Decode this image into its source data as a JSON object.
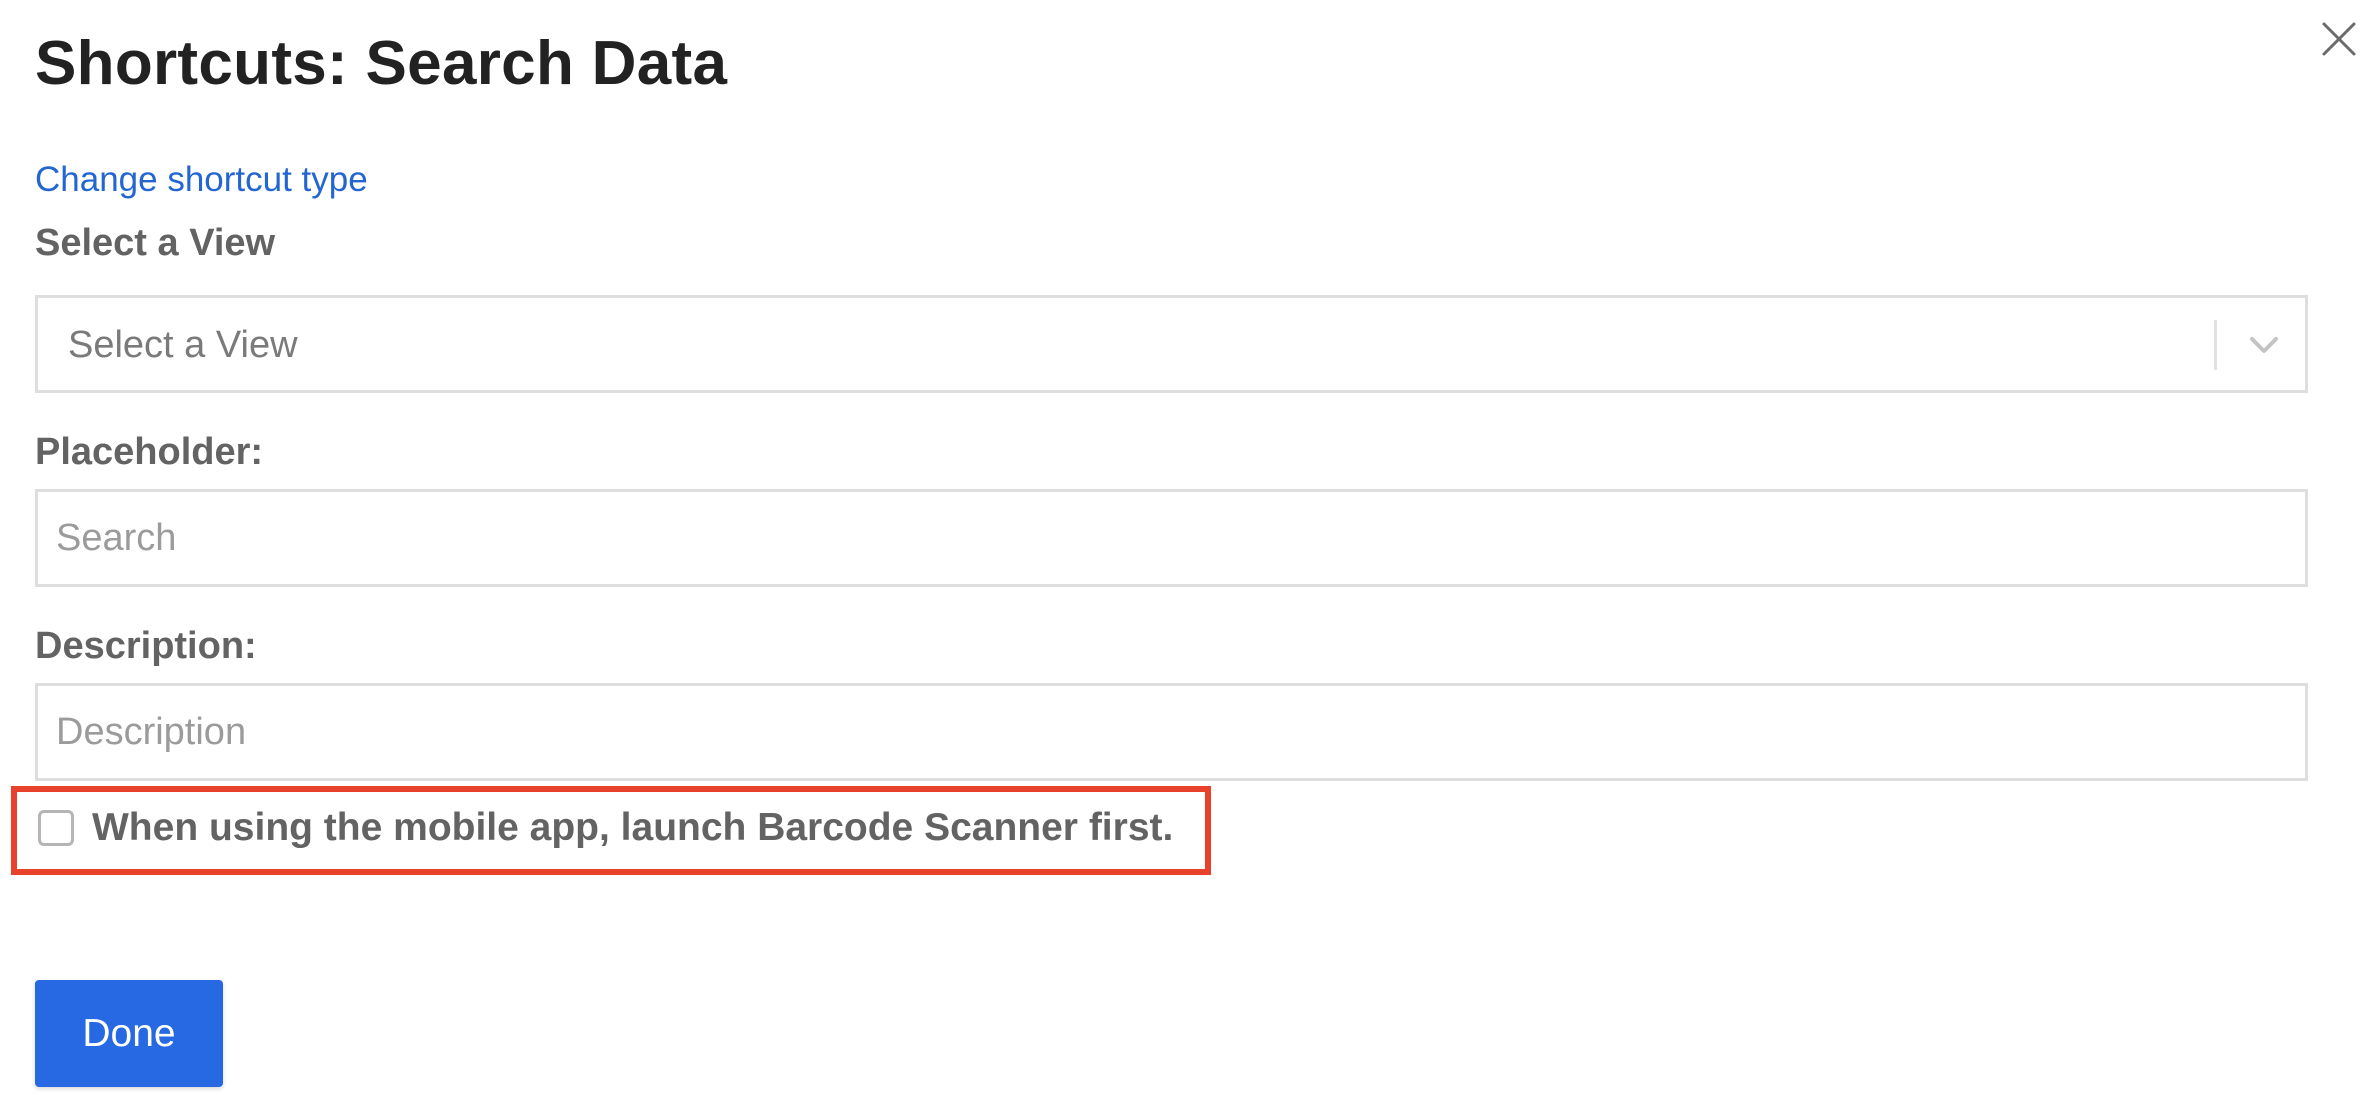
{
  "dialog": {
    "title": "Shortcuts: Search Data",
    "close_icon": "close-icon",
    "change_shortcut_link": "Change shortcut type"
  },
  "view_select": {
    "label": "Select a View",
    "placeholder": "Select a View",
    "chevron_icon": "chevron-down-icon"
  },
  "placeholder_field": {
    "label": "Placeholder:",
    "placeholder": "Search",
    "value": ""
  },
  "description_field": {
    "label": "Description:",
    "placeholder": "Description",
    "value": ""
  },
  "barcode_option": {
    "label": "When using the mobile app, launch Barcode Scanner first.",
    "checked": false,
    "highlight_color": "#e8412c"
  },
  "footer": {
    "done_label": "Done",
    "done_color": "#2768e3"
  },
  "colors": {
    "link": "#2366d1",
    "title": "#222222",
    "label": "#636363",
    "border": "#dedede"
  }
}
